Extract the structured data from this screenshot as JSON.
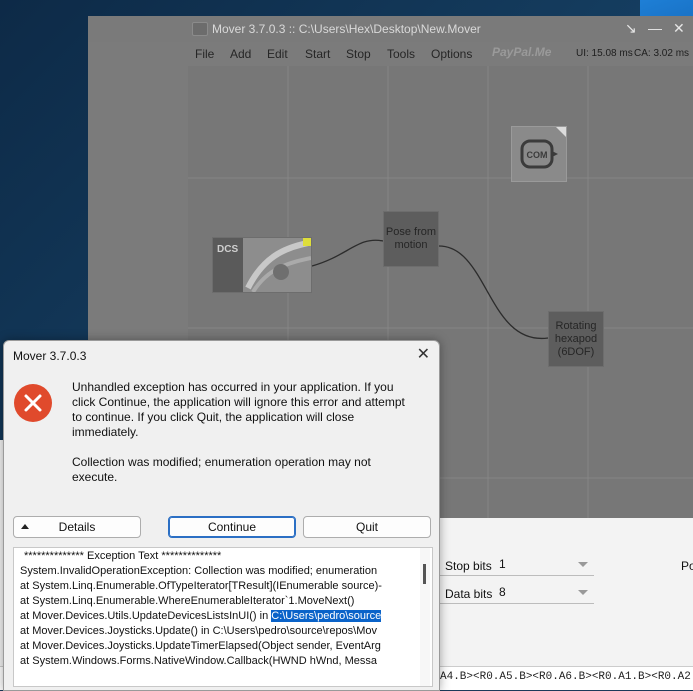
{
  "background_window": {
    "stop_bits_label": "Stop bits",
    "stop_bits_value": "1",
    "data_bits_label": "Data bits",
    "data_bits_value": "8",
    "edge_label": "Po",
    "serial_text": "A4.B><R0.A5.B><R0.A6.B><R0.A1.B><R0.A2.B><0>"
  },
  "mover_window": {
    "title": "Mover 3.7.0.3 :: C:\\Users\\Hex\\Desktop\\New.Mover",
    "controls": {
      "collapse": "↘",
      "minimize": "—",
      "close": "✕"
    },
    "menu": [
      "File",
      "Add",
      "Edit",
      "Start",
      "Stop",
      "Tools",
      "Options"
    ],
    "paypal": "PayPal.Me",
    "ui_stat": "UI: 15.08 ms",
    "ca_stat": "CA: 3.02 ms",
    "nodes": {
      "com_label": "COM",
      "dcs_label": "DCS",
      "pose": [
        "Pose from",
        "motion"
      ],
      "hexapod": [
        "Rotating",
        "hexapod",
        "(6DOF)"
      ]
    }
  },
  "dialog": {
    "title": "Mover 3.7.0.3",
    "close": "✕",
    "message": "Unhandled exception has occurred in your application. If you click Continue, the application will ignore this error and attempt to continue. If you click Quit, the application will close immediately.",
    "detail": "Collection was modified; enumeration operation may not execute.",
    "buttons": {
      "details": "Details",
      "continue": "Continue",
      "quit": "Quit"
    },
    "exception_lines": [
      "************** Exception Text **************",
      "System.InvalidOperationException: Collection was modified; enumeration",
      "   at System.Linq.Enumerable.OfTypeIterator[TResult](IEnumerable source)-",
      "   at System.Linq.Enumerable.WhereEnumerableIterator`1.MoveNext()",
      "   at Mover.Devices.Utils.UpdateDevicesListsInUI() in ",
      "   at Mover.Devices.Joysticks.Update() in C:\\Users\\pedro\\source\\repos\\Mov",
      "   at Mover.Devices.Joysticks.UpdateTimerElapsed(Object sender, EventArg",
      "   at System.Windows.Forms.NativeWindow.Callback(HWND hWnd, Messa"
    ],
    "highlight_text": "C:\\Users\\pedro\\source"
  }
}
